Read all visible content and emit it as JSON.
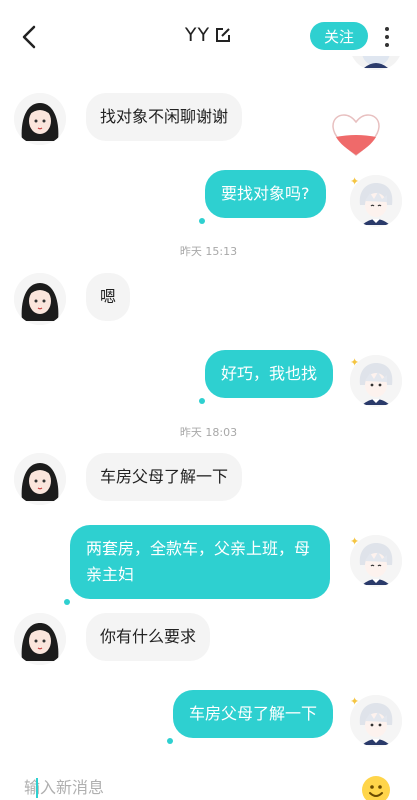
{
  "header": {
    "back_icon": "chevron-left-icon",
    "title": "YY",
    "edit_icon": "edit-icon",
    "follow_label": "关注",
    "more_icon": "more-vertical-icon"
  },
  "messages": [
    {
      "side": "left",
      "text": "找对象不闲聊谢谢"
    },
    {
      "side": "right",
      "text": "要找对象吗?"
    },
    {
      "side": "time",
      "text": "昨天 15:13"
    },
    {
      "side": "left",
      "text": "嗯"
    },
    {
      "side": "right",
      "text": "好巧，我也找"
    },
    {
      "side": "time",
      "text": "昨天 18:03"
    },
    {
      "side": "left",
      "text": "车房父母了解一下"
    },
    {
      "side": "right",
      "text": "两套房，全款车，父亲上班，母亲主妇"
    },
    {
      "side": "left",
      "text": "你有什么要求"
    },
    {
      "side": "right",
      "text": "车房父母了解一下"
    }
  ],
  "input": {
    "placeholder": "输入新消息",
    "emoji_icon": "emoji-icon"
  },
  "colors": {
    "accent": "#2ed0d0",
    "incoming_bubble": "#f4f4f4",
    "timestamp": "#a8a8a8"
  }
}
